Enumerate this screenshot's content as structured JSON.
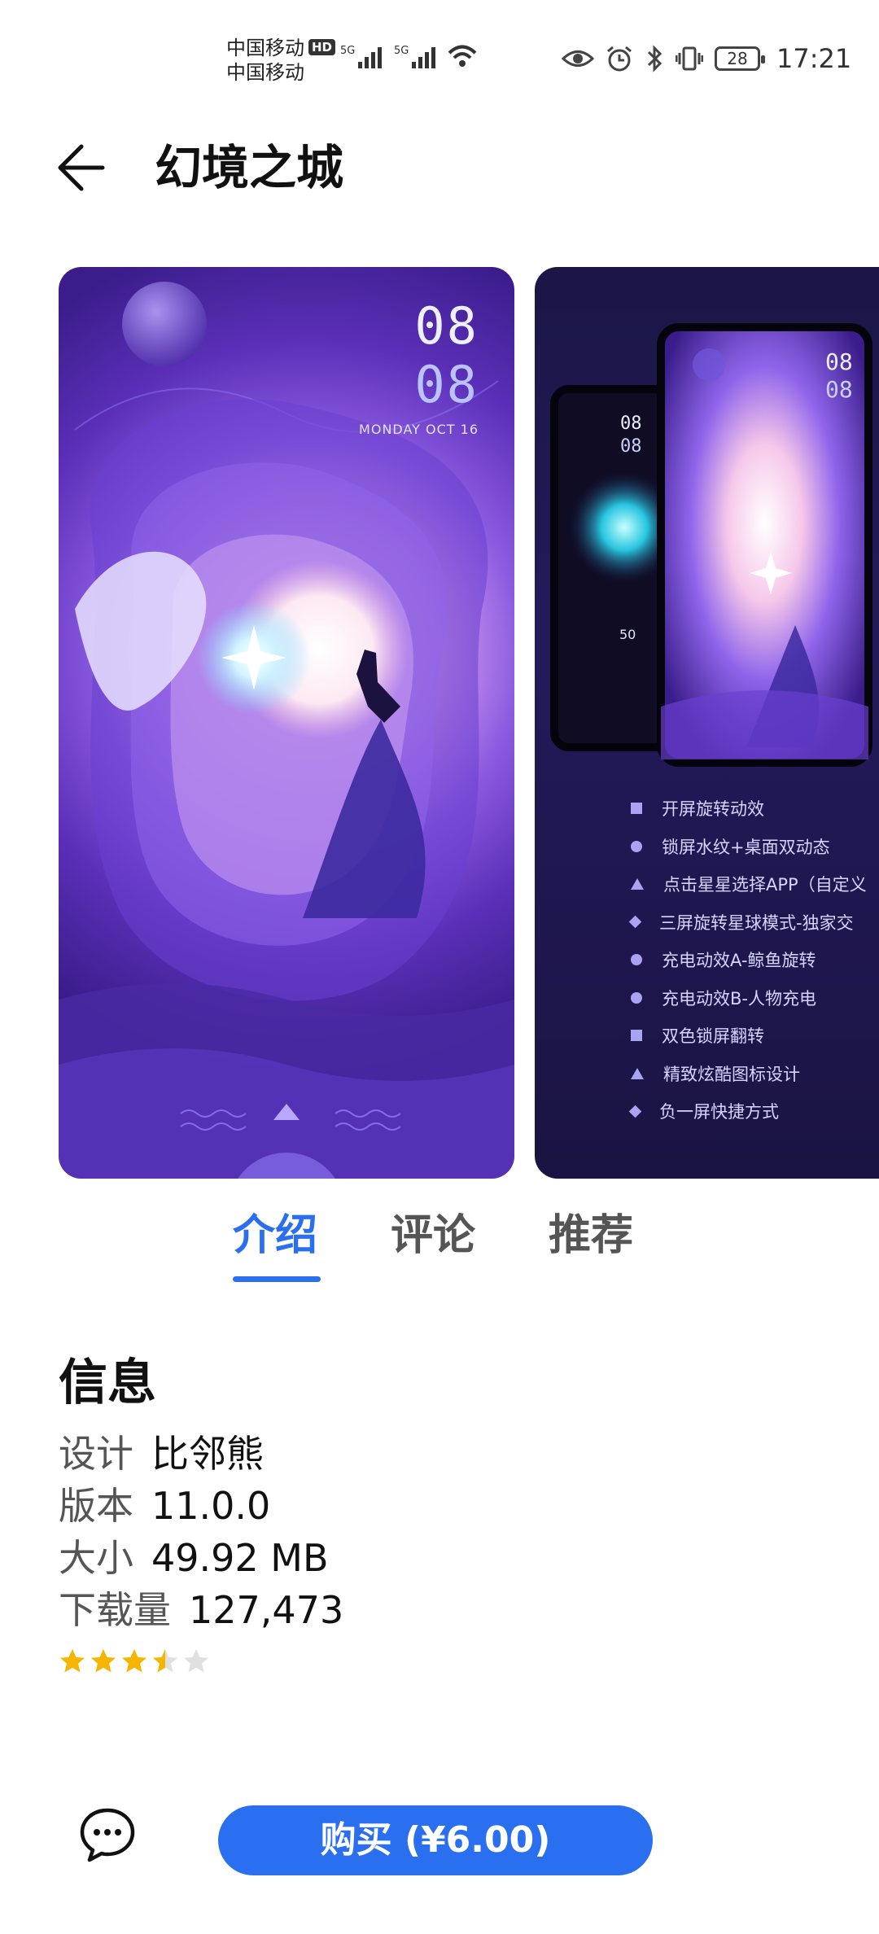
{
  "status_bar": {
    "carrier_1": "中国移动",
    "carrier_2": "中国移动",
    "hd_badge": "HD",
    "network_1": "5G",
    "network_2": "5G",
    "battery": "28",
    "time": "17:21"
  },
  "header": {
    "title": "幻境之城"
  },
  "previews": {
    "lock_clock_hour": "08",
    "lock_clock_minute": "08",
    "lock_date": "MONDAY OCT 16",
    "mini_clock_hour": "08",
    "mini_clock_minute": "08",
    "mini_left_hour": "08",
    "mini_left_minute": "08",
    "mini_left_charge": "50",
    "features": [
      "开屏旋转动效",
      "锁屏水纹+桌面双动态",
      "点击星星选择APP（自定义",
      "三屏旋转星球模式-独家交",
      "充电动效A-鲸鱼旋转",
      "充电动效B-人物充电",
      "双色锁屏翻转",
      "精致炫酷图标设计",
      "负一屏快捷方式"
    ]
  },
  "tabs": [
    {
      "label": "介绍",
      "active": true
    },
    {
      "label": "评论",
      "active": false
    },
    {
      "label": "推荐",
      "active": false
    }
  ],
  "info": {
    "heading": "信息",
    "designer_label": "设计",
    "designer_value": "比邻熊",
    "version_label": "版本",
    "version_value": "11.0.0",
    "size_label": "大小",
    "size_value": "49.92 MB",
    "downloads_label": "下载量",
    "downloads_value": "127,473",
    "rating": 3.5,
    "rating_max": 5
  },
  "bottom": {
    "buy_label": "购买 (¥6.00)"
  },
  "colors": {
    "accent": "#2a6ff0",
    "star": "#f7b500",
    "star_empty": "#e0e0e0"
  }
}
